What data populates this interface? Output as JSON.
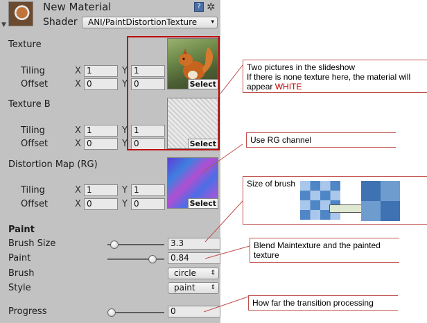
{
  "header": {
    "title": "New Material",
    "shader_label": "Shader",
    "shader_value": "ANI/PaintDistortionTexture"
  },
  "textures": [
    {
      "label": "Texture",
      "tiling_label": "Tiling",
      "offset_label": "Offset",
      "tiling_x": "1",
      "tiling_y": "1",
      "offset_x": "0",
      "offset_y": "0",
      "select_label": "Select"
    },
    {
      "label": "Texture B",
      "tiling_label": "Tiling",
      "offset_label": "Offset",
      "tiling_x": "1",
      "tiling_y": "1",
      "offset_x": "0",
      "offset_y": "0",
      "select_label": "Select"
    },
    {
      "label": "Distortion Map (RG)",
      "tiling_label": "Tiling",
      "offset_label": "Offset",
      "tiling_x": "1",
      "tiling_y": "1",
      "offset_x": "0",
      "offset_y": "0",
      "select_label": "Select"
    }
  ],
  "axis": {
    "x": "X",
    "y": "Y"
  },
  "paint": {
    "section_label": "Paint",
    "brush_size_label": "Brush Size",
    "brush_size_value": "3.3",
    "brush_size_fraction": 0.05,
    "paint_label": "Paint",
    "paint_value": "0.84",
    "paint_fraction": 0.84,
    "brush_label": "Brush",
    "brush_value": "circle",
    "style_label": "Style",
    "style_value": "paint",
    "progress_label": "Progress",
    "progress_value": "0",
    "progress_fraction": 0.0
  },
  "annotations": {
    "slideshow_line1": "Two pictures in the slideshow",
    "slideshow_line2": "If there is none texture here, the material will appear ",
    "slideshow_highlight": "WHITE",
    "rg_channel": "Use RG channel",
    "brush_size": "Size of brush",
    "blend": "Blend Maintexture and the painted texture",
    "progress": "How far the transition processing"
  },
  "colors": {
    "inspector_bg": "#c2c2c2",
    "highlight_red": "#c00000",
    "callout_line": "#c0504d"
  }
}
